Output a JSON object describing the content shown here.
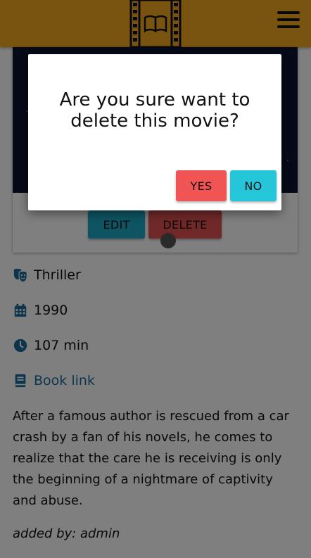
{
  "header": {
    "logo_icon": "film-book-icon",
    "menu_icon": "hamburger-menu-icon",
    "color": "#f0a821"
  },
  "card": {
    "edit_label": "EDIT",
    "delete_label": "DELETE"
  },
  "details": {
    "genre_icon": "theater-masks-icon",
    "genre": "Thriller",
    "year_icon": "calendar-icon",
    "year": "1990",
    "runtime_icon": "clock-icon",
    "runtime": "107 min",
    "book_icon": "book-icon",
    "book_link": "Book link",
    "description": "After a famous author is rescued from a car crash by a fan of his novels, he comes to realize that the care he is receiving is only the beginning of a nightmare of captivity and abuse.",
    "added_by": "added by: admin"
  },
  "dialog": {
    "message": "Are you sure want to delete this movie?",
    "yes_label": "YES",
    "no_label": "NO",
    "yes_color": "#f05454",
    "no_color": "#26c6da"
  }
}
